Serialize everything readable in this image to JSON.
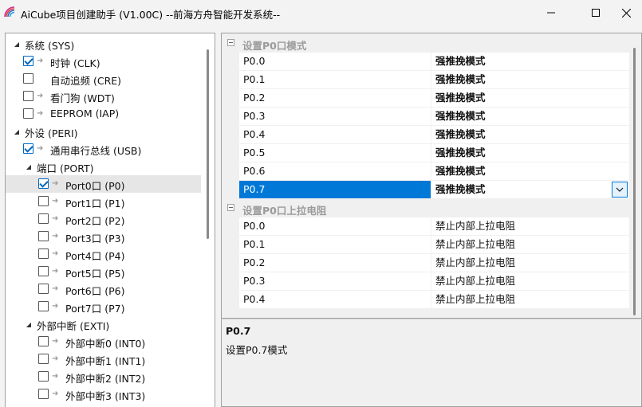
{
  "window": {
    "title": "AiCube项目创建助手 (V1.00C) --前海方舟智能开发系统--"
  },
  "tree": {
    "items": [
      {
        "label": "系统 (SYS)",
        "level": 0,
        "expandable": true,
        "checkbox": false,
        "checked": false,
        "arrow": false
      },
      {
        "label": "时钟 (CLK)",
        "level": 1,
        "expandable": false,
        "checkbox": true,
        "checked": true,
        "arrow": true
      },
      {
        "label": "自动追频 (CRE)",
        "level": 1,
        "expandable": false,
        "checkbox": true,
        "checked": false,
        "arrow": false
      },
      {
        "label": "看门狗 (WDT)",
        "level": 1,
        "expandable": false,
        "checkbox": true,
        "checked": false,
        "arrow": true
      },
      {
        "label": "EEPROM (IAP)",
        "level": 1,
        "expandable": false,
        "checkbox": true,
        "checked": false,
        "arrow": true
      },
      {
        "label": "外设 (PERI)",
        "level": 0,
        "expandable": true,
        "checkbox": false,
        "checked": false,
        "arrow": false
      },
      {
        "label": "通用串行总线 (USB)",
        "level": 1,
        "expandable": false,
        "checkbox": true,
        "checked": true,
        "arrow": true
      },
      {
        "label": "端口 (PORT)",
        "level": 1,
        "expandable": true,
        "checkbox": false,
        "checked": false,
        "arrow": false
      },
      {
        "label": "Port0口 (P0)",
        "level": 2,
        "expandable": false,
        "checkbox": true,
        "checked": true,
        "arrow": true,
        "selected": true
      },
      {
        "label": "Port1口 (P1)",
        "level": 2,
        "expandable": false,
        "checkbox": true,
        "checked": false,
        "arrow": true
      },
      {
        "label": "Port2口 (P2)",
        "level": 2,
        "expandable": false,
        "checkbox": true,
        "checked": false,
        "arrow": true
      },
      {
        "label": "Port3口 (P3)",
        "level": 2,
        "expandable": false,
        "checkbox": true,
        "checked": false,
        "arrow": true
      },
      {
        "label": "Port4口 (P4)",
        "level": 2,
        "expandable": false,
        "checkbox": true,
        "checked": false,
        "arrow": true
      },
      {
        "label": "Port5口 (P5)",
        "level": 2,
        "expandable": false,
        "checkbox": true,
        "checked": false,
        "arrow": true
      },
      {
        "label": "Port6口 (P6)",
        "level": 2,
        "expandable": false,
        "checkbox": true,
        "checked": false,
        "arrow": true
      },
      {
        "label": "Port7口 (P7)",
        "level": 2,
        "expandable": false,
        "checkbox": true,
        "checked": false,
        "arrow": true
      },
      {
        "label": "外部中断 (EXTI)",
        "level": 1,
        "expandable": true,
        "checkbox": false,
        "checked": false,
        "arrow": false
      },
      {
        "label": "外部中断0 (INT0)",
        "level": 2,
        "expandable": false,
        "checkbox": true,
        "checked": false,
        "arrow": true
      },
      {
        "label": "外部中断1 (INT1)",
        "level": 2,
        "expandable": false,
        "checkbox": true,
        "checked": false,
        "arrow": true
      },
      {
        "label": "外部中断2 (INT2)",
        "level": 2,
        "expandable": false,
        "checkbox": true,
        "checked": false,
        "arrow": true
      },
      {
        "label": "外部中断3 (INT3)",
        "level": 2,
        "expandable": false,
        "checkbox": true,
        "checked": false,
        "arrow": true
      }
    ]
  },
  "grid": {
    "categories": [
      {
        "label": "设置P0口模式",
        "rows": [
          {
            "name": "P0.0",
            "value": "强推挽模式"
          },
          {
            "name": "P0.1",
            "value": "强推挽模式"
          },
          {
            "name": "P0.2",
            "value": "强推挽模式"
          },
          {
            "name": "P0.3",
            "value": "强推挽模式"
          },
          {
            "name": "P0.4",
            "value": "强推挽模式"
          },
          {
            "name": "P0.5",
            "value": "强推挽模式"
          },
          {
            "name": "P0.6",
            "value": "强推挽模式"
          },
          {
            "name": "P0.7",
            "value": "强推挽模式",
            "selected": true
          }
        ],
        "bold_values": true
      },
      {
        "label": "设置P0口上拉电阻",
        "rows": [
          {
            "name": "P0.0",
            "value": "禁止内部上拉电阻"
          },
          {
            "name": "P0.1",
            "value": "禁止内部上拉电阻"
          },
          {
            "name": "P0.2",
            "value": "禁止内部上拉电阻"
          },
          {
            "name": "P0.3",
            "value": "禁止内部上拉电阻"
          },
          {
            "name": "P0.4",
            "value": "禁止内部上拉电阻"
          }
        ],
        "bold_values": false
      }
    ]
  },
  "description": {
    "title": "P0.7",
    "text": "设置P0.7模式"
  },
  "colors": {
    "selection": "#0078d7",
    "checkbox_accent": "#0067c0"
  }
}
